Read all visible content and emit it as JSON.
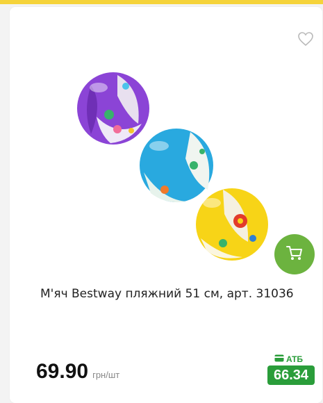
{
  "product": {
    "title": "М'яч Bestway пляжний 51 см, арт. 31036",
    "price": "69.90",
    "price_unit": "грн/шт",
    "atb_label": "АТБ",
    "atb_price": "66.34"
  },
  "icons": {
    "wishlist": "heart-outline-icon",
    "cart": "cart-icon",
    "atb_logo": "atb-card-icon"
  },
  "colors": {
    "accent_top": "#f5d33a",
    "cart_button": "#6cb33f",
    "atb_green": "#2a9d3a"
  }
}
